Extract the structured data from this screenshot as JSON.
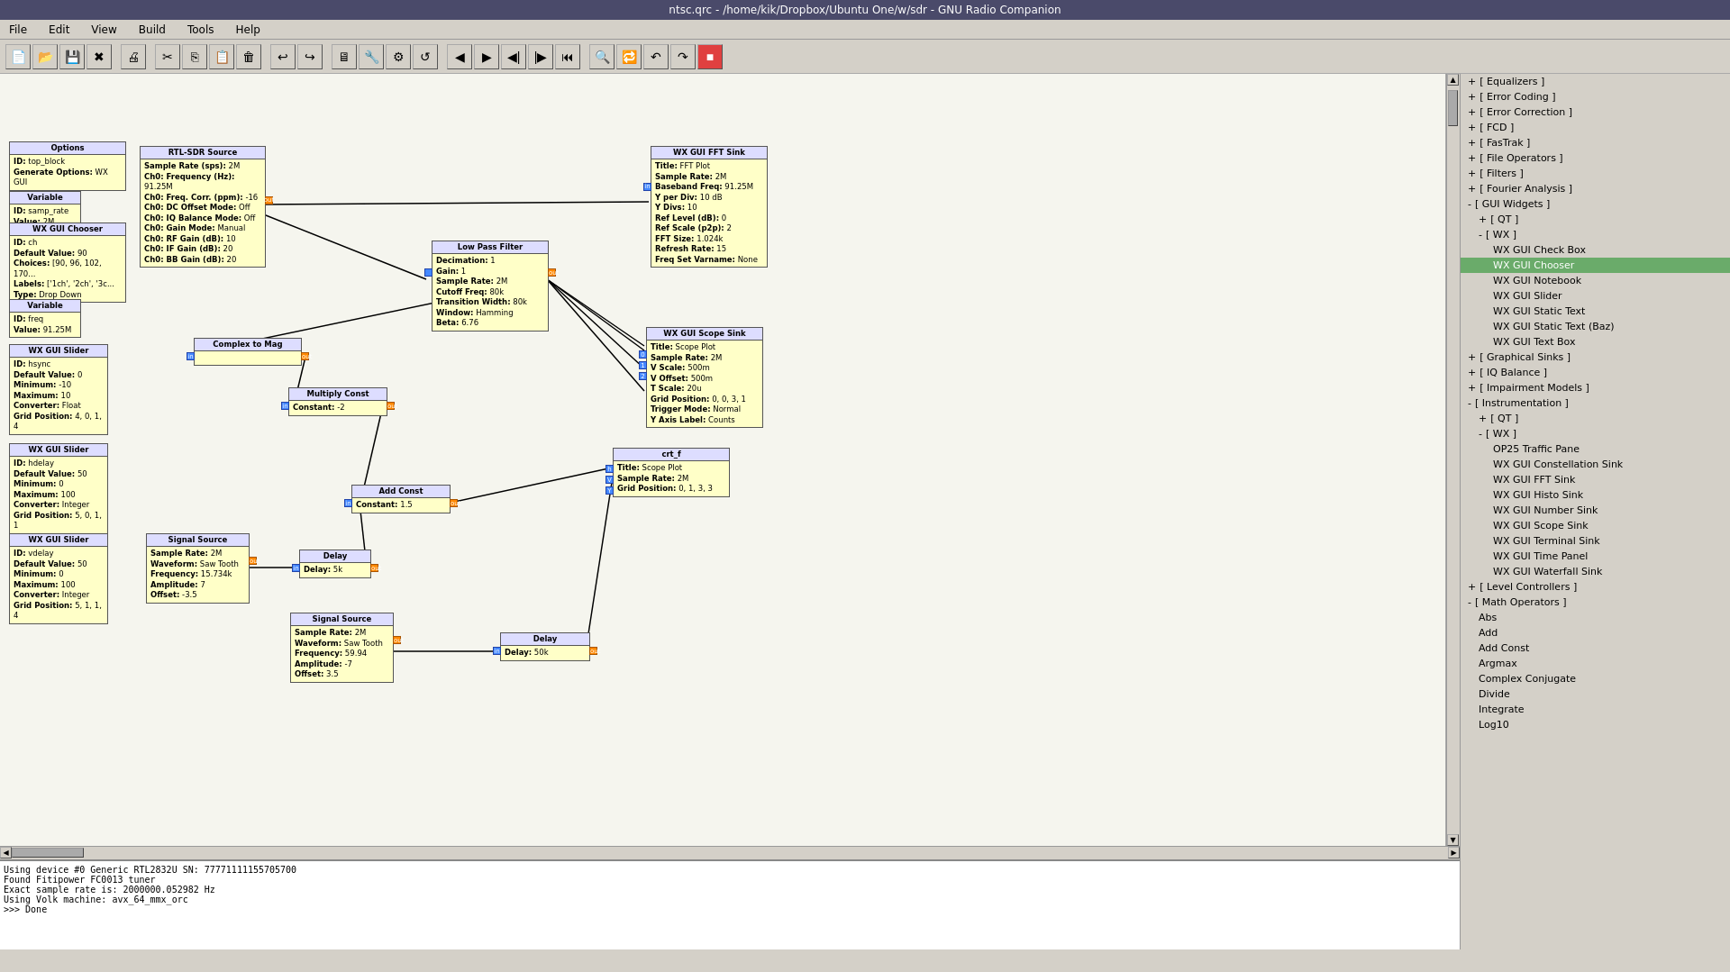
{
  "titlebar": "ntsc.qrc - /home/kik/Dropbox/Ubuntu One/w/sdr - GNU Radio Companion",
  "menu": {
    "items": [
      "File",
      "Edit",
      "View",
      "Build",
      "Tools",
      "Help"
    ]
  },
  "toolbar": {
    "buttons": [
      "new",
      "open",
      "save",
      "close",
      "print",
      "cut",
      "copy",
      "paste",
      "delete",
      "undo",
      "redo",
      "screen",
      "properties",
      "preferences",
      "revert",
      "back",
      "forward",
      "back2",
      "fwd2",
      "back3",
      "fwd3",
      "zoom-in",
      "loop",
      "rotate-left",
      "rotate-right",
      "kill"
    ]
  },
  "blocks": {
    "options": {
      "title": "Options",
      "fields": [
        {
          "label": "ID:",
          "value": "top_block"
        },
        {
          "label": "Generate Options:",
          "value": "WX GUI"
        }
      ]
    },
    "variable_samp": {
      "title": "Variable",
      "fields": [
        {
          "label": "ID:",
          "value": "samp_rate"
        },
        {
          "label": "Value:",
          "value": "2M"
        }
      ]
    },
    "wx_gui_chooser": {
      "title": "WX GUI Chooser",
      "fields": [
        {
          "label": "ID:",
          "value": "ch"
        },
        {
          "label": "Default Value:",
          "value": "90"
        },
        {
          "label": "Choices:",
          "value": "[90, 96, 102, 170..."
        },
        {
          "label": "Labels:",
          "value": "['1ch', '2ch', '3c..."
        },
        {
          "label": "Type:",
          "value": "Drop Down"
        }
      ]
    },
    "variable_freq": {
      "title": "Variable",
      "fields": [
        {
          "label": "ID:",
          "value": "freq"
        },
        {
          "label": "Value:",
          "value": "91.25M"
        }
      ]
    },
    "wx_gui_slider1": {
      "title": "WX GUI Slider",
      "fields": [
        {
          "label": "ID:",
          "value": "hsync"
        },
        {
          "label": "Default Value:",
          "value": "0"
        },
        {
          "label": "Minimum:",
          "value": "-10"
        },
        {
          "label": "Maximum:",
          "value": "10"
        },
        {
          "label": "Converter:",
          "value": "Float"
        },
        {
          "label": "Grid Position:",
          "value": "4, 0, 1, 4"
        }
      ]
    },
    "wx_gui_slider2": {
      "title": "WX GUI Slider",
      "fields": [
        {
          "label": "ID:",
          "value": "hdelay"
        },
        {
          "label": "Default Value:",
          "value": "50"
        },
        {
          "label": "Minimum:",
          "value": "0"
        },
        {
          "label": "Maximum:",
          "value": "100"
        },
        {
          "label": "Converter:",
          "value": "Integer"
        },
        {
          "label": "Grid Position:",
          "value": "5, 0, 1, 1"
        }
      ]
    },
    "wx_gui_slider3": {
      "title": "WX GUI Slider",
      "fields": [
        {
          "label": "ID:",
          "value": "vdelay"
        },
        {
          "label": "Default Value:",
          "value": "50"
        },
        {
          "label": "Minimum:",
          "value": "0"
        },
        {
          "label": "Maximum:",
          "value": "100"
        },
        {
          "label": "Converter:",
          "value": "Integer"
        },
        {
          "label": "Grid Position:",
          "value": "5, 1, 1, 4"
        }
      ]
    },
    "rtl_sdr": {
      "title": "RTL-SDR Source",
      "fields": [
        {
          "label": "Sample Rate (sps):",
          "value": "2M"
        },
        {
          "label": "Ch0: Frequency (Hz):",
          "value": "91.25M"
        },
        {
          "label": "Ch0: Freq. Corr. (ppm):",
          "value": "-16"
        },
        {
          "label": "Ch0: DC Offset Mode:",
          "value": "Off"
        },
        {
          "label": "Ch0: IQ Balance Mode:",
          "value": "Off"
        },
        {
          "label": "Ch0: Gain Mode:",
          "value": "Manual"
        },
        {
          "label": "Ch0: RF Gain (dB):",
          "value": "10"
        },
        {
          "label": "Ch0: IF Gain (dB):",
          "value": "20"
        },
        {
          "label": "Ch0: BB Gain (dB):",
          "value": "20"
        }
      ]
    },
    "low_pass_filter": {
      "title": "Low Pass Filter",
      "fields": [
        {
          "label": "Decimation:",
          "value": "1"
        },
        {
          "label": "Gain:",
          "value": "1"
        },
        {
          "label": "Sample Rate:",
          "value": "2M"
        },
        {
          "label": "Cutoff Freq:",
          "value": "80k"
        },
        {
          "label": "Transition Width:",
          "value": "80k"
        },
        {
          "label": "Window:",
          "value": "Hamming"
        },
        {
          "label": "Beta:",
          "value": "6.76"
        }
      ]
    },
    "multiply_const": {
      "title": "Multiply Const",
      "fields": [
        {
          "label": "Constant:",
          "value": "-2"
        }
      ]
    },
    "add_const": {
      "title": "Add Const",
      "fields": [
        {
          "label": "Constant:",
          "value": "1.5"
        }
      ]
    },
    "complex_to_mag": {
      "title": "Complex to Mag",
      "fields": []
    },
    "signal_source1": {
      "title": "Signal Source",
      "fields": [
        {
          "label": "Sample Rate:",
          "value": "2M"
        },
        {
          "label": "Waveform:",
          "value": "Saw Tooth"
        },
        {
          "label": "Frequency:",
          "value": "15.734k"
        },
        {
          "label": "Amplitude:",
          "value": "7"
        },
        {
          "label": "Offset:",
          "value": "-3.5"
        }
      ]
    },
    "signal_source2": {
      "title": "Signal Source",
      "fields": [
        {
          "label": "Sample Rate:",
          "value": "2M"
        },
        {
          "label": "Waveform:",
          "value": "Saw Tooth"
        },
        {
          "label": "Frequency:",
          "value": "59.94"
        },
        {
          "label": "Amplitude:",
          "value": "-7"
        },
        {
          "label": "Offset:",
          "value": "3.5"
        }
      ]
    },
    "delay1": {
      "title": "Delay",
      "fields": [
        {
          "label": "Delay:",
          "value": "5k"
        }
      ]
    },
    "delay2": {
      "title": "Delay",
      "fields": [
        {
          "label": "Delay:",
          "value": "50k"
        }
      ]
    },
    "wx_gui_fft_sink": {
      "title": "WX GUI FFT Sink",
      "fields": [
        {
          "label": "Title:",
          "value": "FFT Plot"
        },
        {
          "label": "Sample Rate:",
          "value": "2M"
        },
        {
          "label": "Baseband Freq:",
          "value": "91.25M"
        },
        {
          "label": "Y per Div:",
          "value": "10 dB"
        },
        {
          "label": "Y Divs:",
          "value": "10"
        },
        {
          "label": "Ref Level (dB):",
          "value": "0"
        },
        {
          "label": "Ref Scale (p2p):",
          "value": "2"
        },
        {
          "label": "FFT Size:",
          "value": "1.024k"
        },
        {
          "label": "Refresh Rate:",
          "value": "15"
        },
        {
          "label": "Freq Set Varname:",
          "value": "None"
        }
      ]
    },
    "wx_gui_scope_sink": {
      "title": "WX GUI Scope Sink",
      "fields": [
        {
          "label": "Title:",
          "value": "Scope Plot"
        },
        {
          "label": "Sample Rate:",
          "value": "2M"
        },
        {
          "label": "V Scale:",
          "value": "500m"
        },
        {
          "label": "V Offset:",
          "value": "500m"
        },
        {
          "label": "T Scale:",
          "value": "20u"
        },
        {
          "label": "Grid Position:",
          "value": "0, 0, 3, 1"
        },
        {
          "label": "Trigger Mode:",
          "value": "Normal"
        },
        {
          "label": "Y Axis Label:",
          "value": "Counts"
        }
      ]
    },
    "crt_f": {
      "title": "crt_f",
      "fields": [
        {
          "label": "Title:",
          "value": "Scope Plot"
        },
        {
          "label": "Sample Rate:",
          "value": "2M"
        },
        {
          "label": "Grid Position:",
          "value": "0, 1, 3, 3"
        }
      ]
    }
  },
  "tree": {
    "items": [
      {
        "label": "[ Equalizers ]",
        "level": 0,
        "expanded": false,
        "selected": false
      },
      {
        "label": "[ Error Coding ]",
        "level": 0,
        "expanded": false,
        "selected": false
      },
      {
        "label": "[ Error Correction ]",
        "level": 0,
        "expanded": false,
        "selected": false
      },
      {
        "label": "[ FCD ]",
        "level": 0,
        "expanded": false,
        "selected": false
      },
      {
        "label": "[ FasTrak ]",
        "level": 0,
        "expanded": false,
        "selected": false
      },
      {
        "label": "[ File Operators ]",
        "level": 0,
        "expanded": false,
        "selected": false
      },
      {
        "label": "[ Filters ]",
        "level": 0,
        "expanded": false,
        "selected": false
      },
      {
        "label": "[ Fourier Analysis ]",
        "level": 0,
        "expanded": false,
        "selected": false
      },
      {
        "label": "[ GUI Widgets ]",
        "level": 0,
        "expanded": true,
        "selected": false
      },
      {
        "label": "[ QT ]",
        "level": 1,
        "expanded": false,
        "selected": false
      },
      {
        "label": "[ WX ]",
        "level": 1,
        "expanded": true,
        "selected": false
      },
      {
        "label": "WX GUI Check Box",
        "level": 2,
        "expanded": false,
        "selected": false
      },
      {
        "label": "WX GUI Chooser",
        "level": 2,
        "expanded": false,
        "selected": true
      },
      {
        "label": "WX GUI Notebook",
        "level": 2,
        "expanded": false,
        "selected": false
      },
      {
        "label": "WX GUI Slider",
        "level": 2,
        "expanded": false,
        "selected": false
      },
      {
        "label": "WX GUI Static Text",
        "level": 2,
        "expanded": false,
        "selected": false
      },
      {
        "label": "WX GUI Static Text (Baz)",
        "level": 2,
        "expanded": false,
        "selected": false
      },
      {
        "label": "WX GUI Text Box",
        "level": 2,
        "expanded": false,
        "selected": false
      },
      {
        "label": "[ Graphical Sinks ]",
        "level": 0,
        "expanded": false,
        "selected": false
      },
      {
        "label": "[ IQ Balance ]",
        "level": 0,
        "expanded": false,
        "selected": false
      },
      {
        "label": "[ Impairment Models ]",
        "level": 0,
        "expanded": false,
        "selected": false
      },
      {
        "label": "[ Instrumentation ]",
        "level": 0,
        "expanded": false,
        "selected": false
      },
      {
        "label": "[ QT ]",
        "level": 1,
        "expanded": false,
        "selected": false
      },
      {
        "label": "[ WX ]",
        "level": 1,
        "expanded": true,
        "selected": false
      },
      {
        "label": "OP25 Traffic Pane",
        "level": 2,
        "expanded": false,
        "selected": false
      },
      {
        "label": "WX GUI Constellation Sink",
        "level": 2,
        "expanded": false,
        "selected": false
      },
      {
        "label": "WX GUI FFT Sink",
        "level": 2,
        "expanded": false,
        "selected": false
      },
      {
        "label": "WX GUI Histo Sink",
        "level": 2,
        "expanded": false,
        "selected": false
      },
      {
        "label": "WX GUI Number Sink",
        "level": 2,
        "expanded": false,
        "selected": false
      },
      {
        "label": "WX GUI Scope Sink",
        "level": 2,
        "expanded": false,
        "selected": false
      },
      {
        "label": "WX GUI Terminal Sink",
        "level": 2,
        "expanded": false,
        "selected": false
      },
      {
        "label": "WX GUI Time Panel",
        "level": 2,
        "expanded": false,
        "selected": false
      },
      {
        "label": "WX GUI Waterfall Sink",
        "level": 2,
        "expanded": false,
        "selected": false
      },
      {
        "label": "[ Level Controllers ]",
        "level": 0,
        "expanded": false,
        "selected": false
      },
      {
        "label": "[ Math Operators ]",
        "level": 0,
        "expanded": true,
        "selected": false
      },
      {
        "label": "Abs",
        "level": 1,
        "expanded": false,
        "selected": false
      },
      {
        "label": "Add",
        "level": 1,
        "expanded": false,
        "selected": false
      },
      {
        "label": "Add Const",
        "level": 1,
        "expanded": false,
        "selected": false
      },
      {
        "label": "Argmax",
        "level": 1,
        "expanded": false,
        "selected": false
      },
      {
        "label": "Complex Conjugate",
        "level": 1,
        "expanded": false,
        "selected": false
      },
      {
        "label": "Divide",
        "level": 1,
        "expanded": false,
        "selected": false
      },
      {
        "label": "Integrate",
        "level": 1,
        "expanded": false,
        "selected": false
      },
      {
        "label": "Log10",
        "level": 1,
        "expanded": false,
        "selected": false
      }
    ]
  },
  "console": {
    "lines": [
      "Using device #0 Generic RTL2832U SN: 77771111155705700",
      "Found Fitipower FC0013 tuner",
      "Exact sample rate is: 2000000.052982 Hz",
      "Using Volk machine: avx_64_mmx_orc",
      "",
      ">>> Done"
    ]
  }
}
